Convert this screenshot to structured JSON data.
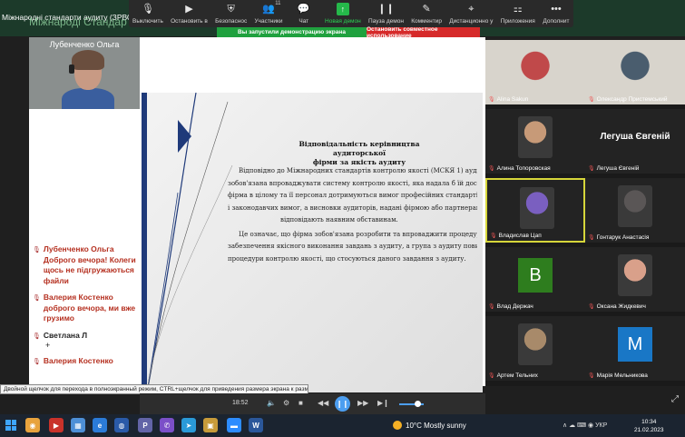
{
  "window": {
    "tab_text": "Міжнародні стандарти аудиту (ЗРВС) Відкрите за",
    "background_title": "Міжнароді Стандар"
  },
  "toolbar": {
    "items": [
      {
        "label": "Выключить",
        "icon": "mic-icon",
        "glyph": "🎙"
      },
      {
        "label": "Остановить в",
        "icon": "video-camera-icon",
        "glyph": "▶"
      },
      {
        "label": "Безопаснос",
        "icon": "shield-icon",
        "glyph": "⛨"
      },
      {
        "label": "Участники",
        "icon": "participants-icon",
        "glyph": "👥",
        "count": "11"
      },
      {
        "label": "Чат",
        "icon": "chat-icon",
        "glyph": "💬"
      },
      {
        "label": "Новая демон",
        "icon": "share-screen-icon",
        "glyph": "↑"
      },
      {
        "label": "Пауза демон",
        "icon": "pause-icon",
        "glyph": "❙❙"
      },
      {
        "label": "Комментир",
        "icon": "annotate-icon",
        "glyph": "✎"
      },
      {
        "label": "Дистанционно у",
        "icon": "remote-control-icon",
        "glyph": "⌖"
      },
      {
        "label": "Приложения",
        "icon": "apps-icon",
        "glyph": "⚏"
      },
      {
        "label": "Дополнит",
        "icon": "more-icon",
        "glyph": "•••"
      }
    ]
  },
  "banner": {
    "on_text": "Вы запустили демонстрацию экрана",
    "stop_text": "Остановить совместное использование"
  },
  "self_video": {
    "name": "Лубенченко Ольга"
  },
  "chat": {
    "messages": [
      {
        "text": "Лубенченко Ольга Доброго вечора! Колеги щось не підгружаються файли",
        "plus": ""
      },
      {
        "text": "Валерия Костенко доброго вечора, ми вже грузимо",
        "plus": ""
      },
      {
        "text": "Светлана Л",
        "plus": "+",
        "dark": true
      },
      {
        "text": "Валерия Костенко",
        "plus": ""
      }
    ]
  },
  "slide": {
    "title_line1": "Відповідальність керівництва аудиторської",
    "title_line2": "фірми за якість аудиту",
    "paragraph1": [
      "Відповідно до Міжнародних стандартів контролю якості (МСКЯ 1) аудиторська фір",
      "зобов'язана впроваджувати систему контролю якості, яка надала б їй достатню впевненість, щ",
      "фірма в цілому та її персонал дотримуються вимог професійних стандартів та норматив",
      "і законодавчих вимог, а висновки аудиторів, надані фірмою або партнерами з завдання,",
      "відповідають наявним обставинам."
    ],
    "paragraph2": [
      "Це означає, що фірма зобов'язана розробити та впроваджити процедури контролю щ",
      "забезпечення якісного виконання завдань з аудиту, а група з аудиту повинна виконувати",
      "процедури контролю якості, що стосуються даного завдання з аудиту."
    ]
  },
  "tooltip": "Двойной щелчок для перехода в полноэкранный режим, CTRL+щелчок для приведения размера экрана к размеру видео",
  "player": {
    "time": "18:52"
  },
  "gallery": {
    "tiles": [
      {
        "name": "Alina Sakun",
        "type": "video",
        "color": "#c0494a"
      },
      {
        "name": "Олександр Пристемський",
        "type": "video",
        "color": "#4a5d6e"
      },
      {
        "name": "Алина Топоровская",
        "type": "photo",
        "color": "#c79a78"
      },
      {
        "name": "Легуша Євгеній",
        "type": "name",
        "bigname": "Легуша Євгеній"
      },
      {
        "name": "Владислав Цап",
        "type": "photo",
        "color": "#7a5fc0",
        "active": true
      },
      {
        "name": "Гонтарук Анастасія",
        "type": "photo",
        "color": "#5a5656"
      },
      {
        "name": "Влад Держач",
        "type": "letter",
        "letter": "B",
        "color": "#2e7d1e"
      },
      {
        "name": "Оксана Жидкевич",
        "type": "photo",
        "color": "#d9a08a"
      },
      {
        "name": "Артем Тельних",
        "type": "photo",
        "color": "#a88a6a"
      },
      {
        "name": "Марія Мельникова",
        "type": "letter",
        "letter": "M",
        "color": "#1977c6"
      }
    ]
  },
  "taskbar": {
    "weather": "10°C  Mostly sunny",
    "tray": "∧  ☁  ⌨  ◉  УКР",
    "time": "10:34",
    "date": "21.02.2023"
  }
}
